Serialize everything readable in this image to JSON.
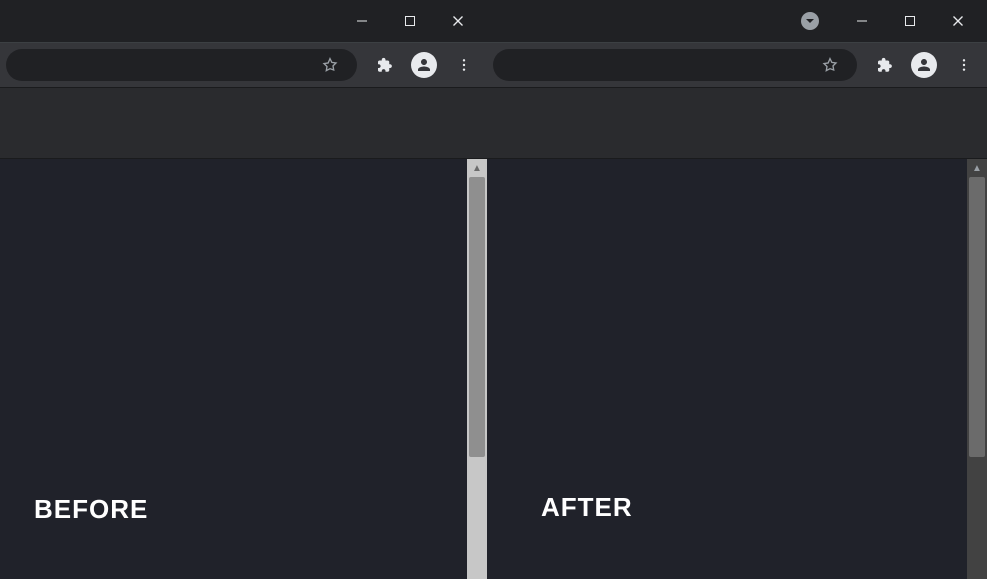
{
  "left_window": {
    "label": "BEFORE"
  },
  "right_window": {
    "label": "AFTER"
  },
  "icons": {
    "minimize": "minimize",
    "maximize": "maximize",
    "close": "close",
    "dropdown": "dropdown",
    "bookmark_star": "star-outline",
    "extensions": "puzzle-piece",
    "profile": "account-circle",
    "menu": "dots-vertical"
  }
}
